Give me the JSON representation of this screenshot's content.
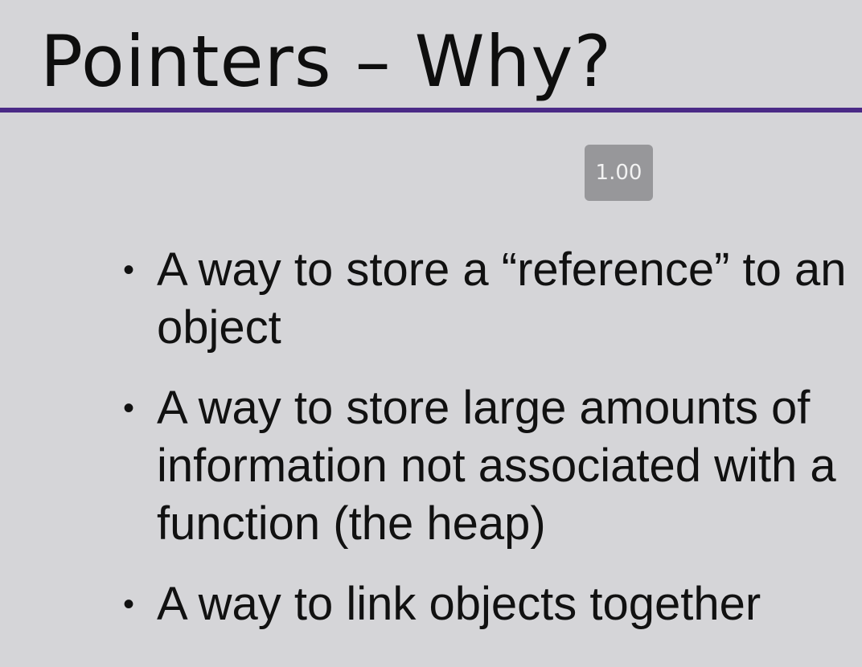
{
  "slide": {
    "title": "Pointers – Why?",
    "speed_badge": "1.00",
    "bullets": [
      "A way to store a “reference” to an object",
      "A way to store large amounts of information not associated with a function (the heap)",
      "A way to link objects together"
    ]
  },
  "colors": {
    "background": "#d5d5d8",
    "accent_rule": "#4a2a86",
    "badge": "#97979a"
  }
}
